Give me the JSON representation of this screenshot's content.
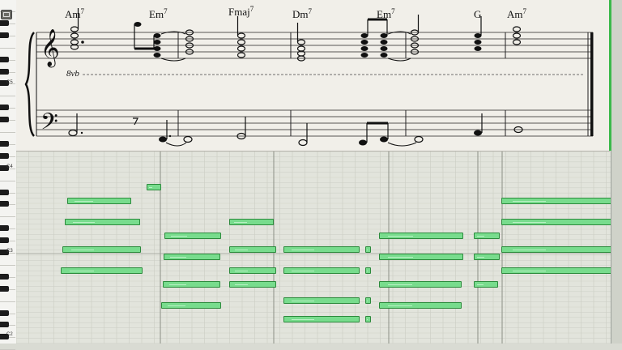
{
  "keyboard": {
    "octave_labels": [
      "C5",
      "C4",
      "C3",
      "C2"
    ]
  },
  "score": {
    "ottava_label": "8vb",
    "chord_symbols": [
      {
        "root": "Am",
        "ext": "7"
      },
      {
        "root": "Em",
        "ext": "7"
      },
      {
        "root": "Fmaj",
        "ext": "7"
      },
      {
        "root": "Dm",
        "ext": "7"
      },
      {
        "root": "Em",
        "ext": "7"
      },
      {
        "root": "G",
        "ext": ""
      },
      {
        "root": "Am",
        "ext": "7"
      }
    ]
  },
  "piano_roll": {
    "note_color": "#78dc8d",
    "note_border": "#2c8a3c"
  },
  "colors": {
    "paper": "#f1efe9",
    "grid_background": "#e2e4dc",
    "accent_green": "#39b94a"
  }
}
